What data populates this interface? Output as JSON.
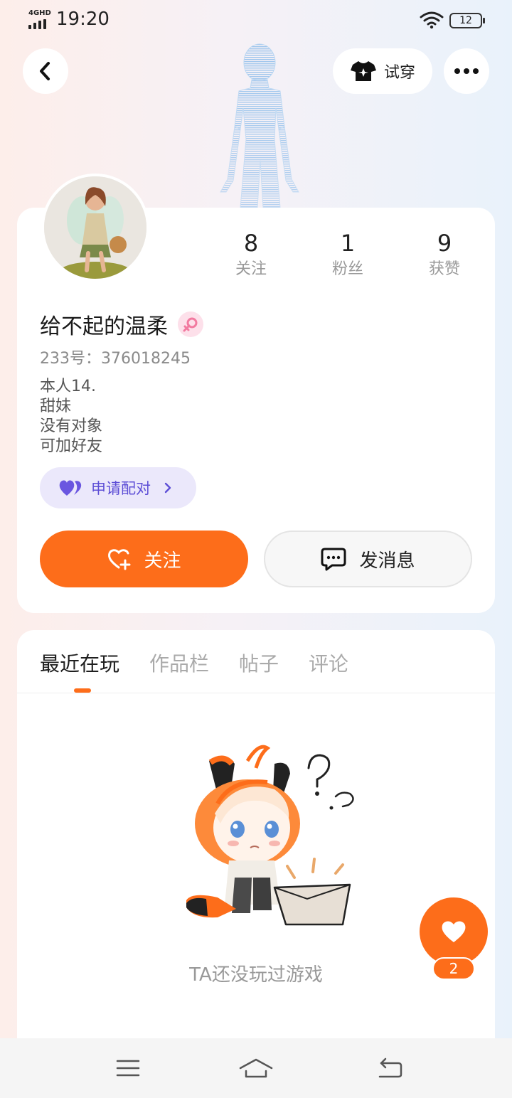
{
  "status_bar": {
    "network": "4GHD",
    "time": "19:20",
    "battery": "12"
  },
  "header": {
    "tryon_label": "试穿"
  },
  "profile": {
    "stats": [
      {
        "value": "8",
        "label": "关注"
      },
      {
        "value": "1",
        "label": "粉丝"
      },
      {
        "value": "9",
        "label": "获赞"
      }
    ],
    "username": "给不起的温柔",
    "user_id": "233号：376018245",
    "bio": [
      "本人14.",
      "甜妹",
      "没有对象",
      "可加好友"
    ],
    "pair_label": "申请配对",
    "follow_label": "关注",
    "message_label": "发消息"
  },
  "tabs": [
    {
      "label": "最近在玩",
      "active": true
    },
    {
      "label": "作品栏",
      "active": false
    },
    {
      "label": "帖子",
      "active": false
    },
    {
      "label": "评论",
      "active": false
    }
  ],
  "empty_state": {
    "text": "TA还没玩过游戏"
  },
  "like_fab": {
    "count": "2"
  },
  "colors": {
    "accent": "#fd6d1a",
    "pair_bg": "#ebe8fb",
    "pair_text": "#5d4ed6"
  }
}
